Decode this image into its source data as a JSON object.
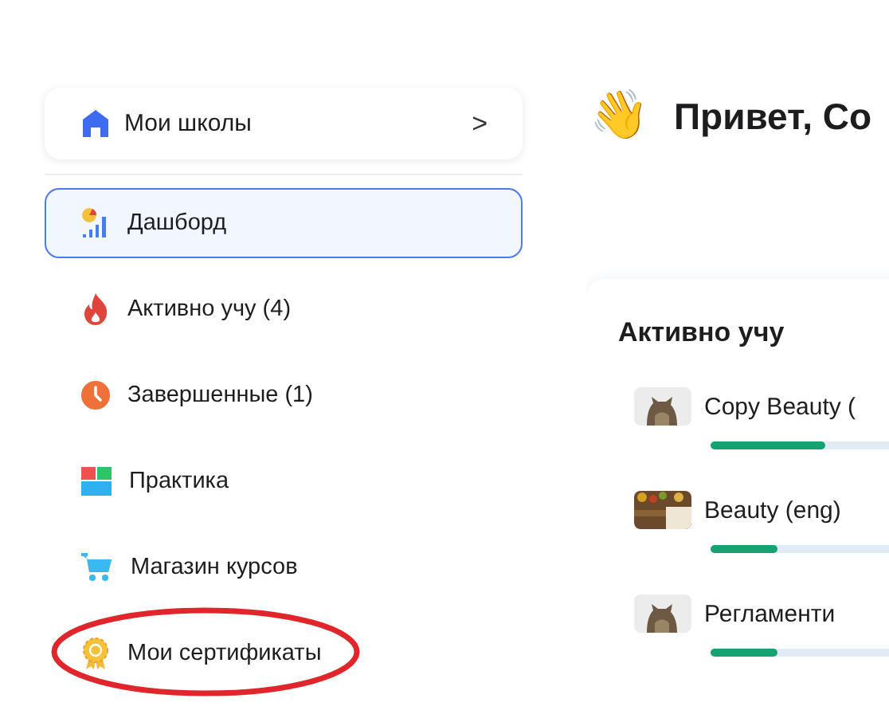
{
  "school_switcher": {
    "label": "Мои школы",
    "chevron": ">"
  },
  "sidebar": {
    "items": [
      {
        "kind": "dashboard",
        "label": "Дашборд",
        "selected": true,
        "circled": false
      },
      {
        "kind": "fire",
        "label": "Активно учу (4)",
        "selected": false,
        "circled": false
      },
      {
        "kind": "clock",
        "label": "Завершенные (1)",
        "selected": false,
        "circled": false
      },
      {
        "kind": "practice",
        "label": "Практика",
        "selected": false,
        "circled": false
      },
      {
        "kind": "cart",
        "label": "Магазин курсов",
        "selected": false,
        "circled": false
      },
      {
        "kind": "medal",
        "label": "Мои сертификаты",
        "selected": false,
        "circled": true
      }
    ]
  },
  "greeting": {
    "emoji": "👋",
    "text": "Привет, Со"
  },
  "active_card": {
    "title": "Активно учу",
    "courses": [
      {
        "title": "Copy Beauty (",
        "level": 0.36
      },
      {
        "title": "Beauty (eng)",
        "level": 0.21
      },
      {
        "title": "Регламенти",
        "level": 0.21
      }
    ]
  }
}
